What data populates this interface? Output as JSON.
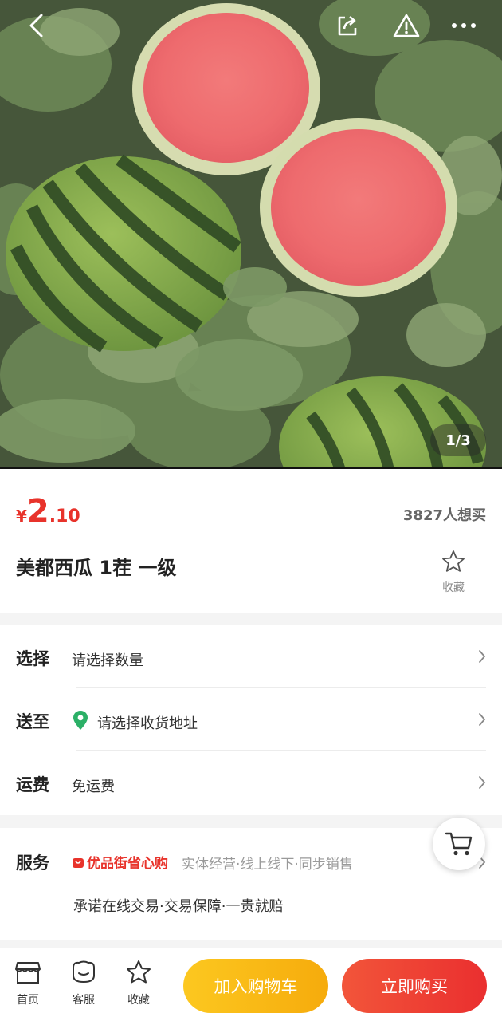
{
  "hero": {
    "pager": "1/3",
    "icons": [
      "back-arrow-icon",
      "share-icon",
      "warning-icon",
      "more-icon"
    ]
  },
  "product": {
    "price_symbol": "¥",
    "price_int": "2",
    "price_dec": ".10",
    "want_count": "3827人想买",
    "title": "美都西瓜 1茬 一级",
    "fav_label": "收藏"
  },
  "options": {
    "select": {
      "label": "选择",
      "value": "请选择数量"
    },
    "ship_to": {
      "label": "送至",
      "value": "请选择收货地址"
    },
    "freight": {
      "label": "运费",
      "value": "免运费"
    }
  },
  "service": {
    "label": "服务",
    "brand": "优品街省心购",
    "tags": "实体经营·线上线下·同步销售",
    "promise": "承诺在线交易·交易保障·一贵就赔"
  },
  "bottom_bar": {
    "home": "首页",
    "support": "客服",
    "favorite": "收藏",
    "add_to_cart": "加入购物车",
    "buy_now": "立即购买"
  },
  "colors": {
    "accent_red": "#e8332b",
    "cart_yellow": "#f8b914",
    "buy_red": "#ee3e33"
  }
}
